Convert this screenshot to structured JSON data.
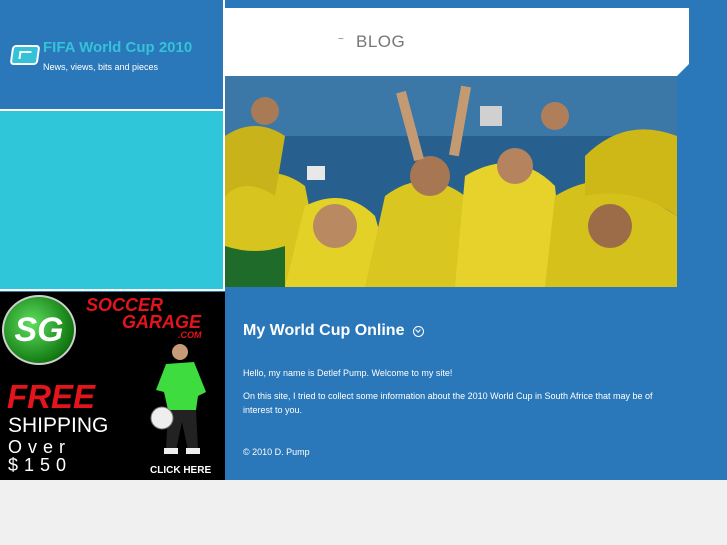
{
  "site": {
    "title": "FIFA World Cup 2010",
    "tagline": "News, views, bits and pieces"
  },
  "header": {
    "separator": "~",
    "nav_label": "BLOG"
  },
  "ad": {
    "brand_line1": "SOCCER",
    "brand_line2": "GARAGE",
    "brand_line3": ".COM",
    "headline": "FREE",
    "line2": "SHIPPING",
    "line3": "Over",
    "line4": "$150",
    "cta": "CLICK HERE",
    "logo_letters": "SG"
  },
  "main": {
    "title": "My World Cup Online",
    "paragraphs": [
      "Hello, my name is Detlef Pump. Welcome to my site!",
      "On this site, I tried to collect some information about the 2010 World Cup in South Africe that may be of interest to you."
    ],
    "copyright": "© 2010 D. Pump"
  },
  "colors": {
    "primary_blue": "#2a78b9",
    "cyan": "#30c6d9",
    "ad_red": "#e3141b"
  }
}
